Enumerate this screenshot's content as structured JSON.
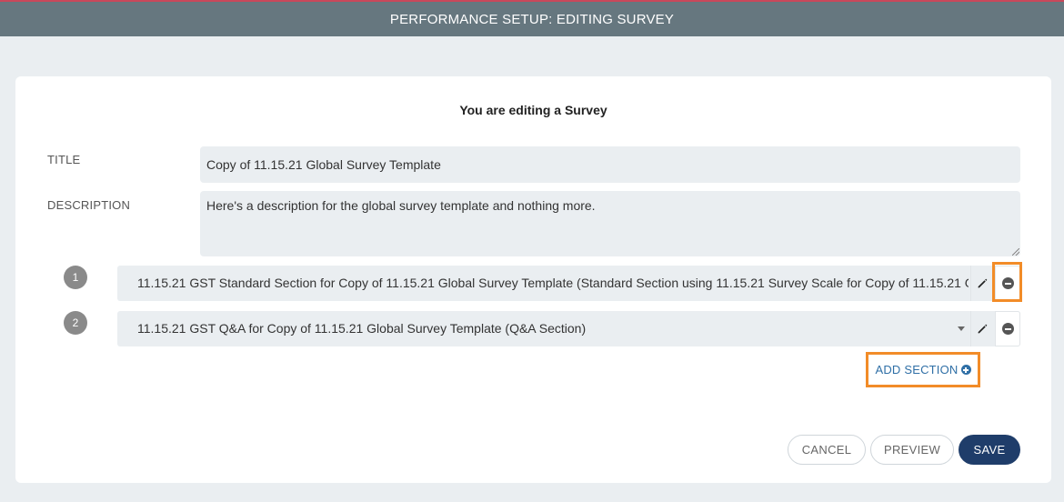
{
  "header": {
    "title": "PERFORMANCE SETUP: EDITING SURVEY"
  },
  "form": {
    "heading": "You are editing a Survey",
    "title_label": "TITLE",
    "title_value": "Copy of 11.15.21 Global Survey Template",
    "description_label": "DESCRIPTION",
    "description_value": "Here's a description for the global survey template and nothing more."
  },
  "sections": [
    {
      "number": "1",
      "value": "11.15.21 GST Standard Section for Copy of 11.15.21 Global Survey Template (Standard Section using 11.15.21 Survey Scale for Copy of 11.15.21 G"
    },
    {
      "number": "2",
      "value": "11.15.21 GST Q&A for Copy of 11.15.21 Global Survey Template (Q&A Section)"
    }
  ],
  "actions": {
    "add_section": "ADD SECTION",
    "cancel": "CANCEL",
    "preview": "PREVIEW",
    "save": "SAVE"
  },
  "colors": {
    "header_bg": "#66777f",
    "highlight": "#f28c28",
    "primary": "#1f3d6a",
    "link": "#2f6fa6"
  }
}
